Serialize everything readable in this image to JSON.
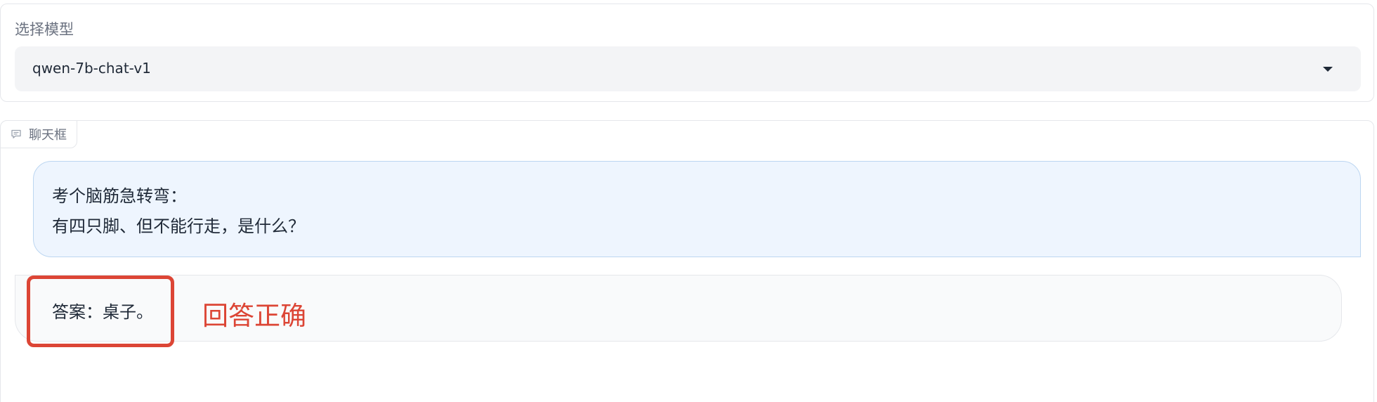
{
  "model_selector": {
    "label": "选择模型",
    "selected_value": "qwen-7b-chat-v1"
  },
  "chatbot": {
    "label": "聊天框",
    "messages": [
      {
        "role": "user",
        "lines": [
          "考个脑筋急转弯：",
          "有四只脚、但不能行走，是什么？"
        ]
      },
      {
        "role": "bot",
        "text": "答案：桌子。"
      }
    ]
  },
  "annotation": {
    "text": "回答正确",
    "color": "#dc4535"
  },
  "colors": {
    "user_bubble_bg": "#eef5fe",
    "user_bubble_border": "#bcd6f1",
    "bot_bubble_bg": "#f9fafb",
    "select_bg": "#f3f4f6"
  },
  "icons": {
    "chat_label": "chat-bubble-icon",
    "dropdown": "dropdown-arrow-icon"
  }
}
